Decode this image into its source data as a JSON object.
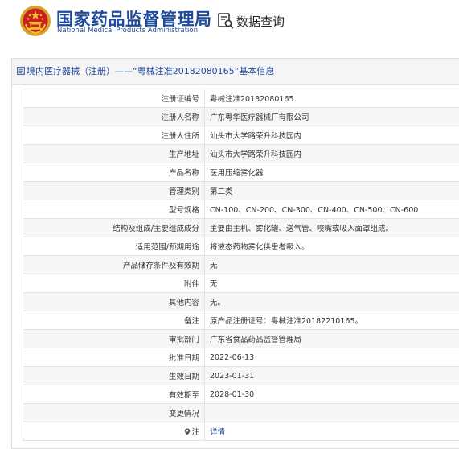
{
  "header": {
    "org_cn": "国家药品监督管理局",
    "org_en": "National Medical Products Administration",
    "query_label": "数据查询",
    "emblem_icon": "national-emblem-icon",
    "query_icon": "search-document-icon",
    "brand_color": "#1e4a9c"
  },
  "panel": {
    "title": "境内医疗器械（注册）——“粤械注准20182080165”基本信息",
    "title_icon": "document-icon"
  },
  "rows": [
    {
      "label": "注册证编号",
      "value": "粤械注准20182080165"
    },
    {
      "label": "注册人名称",
      "value": "广东粤华医疗器械厂有限公司"
    },
    {
      "label": "注册人住所",
      "value": "汕头市大学路荣升科技园内"
    },
    {
      "label": "生产地址",
      "value": "汕头市大学路荣升科技园内"
    },
    {
      "label": "产品名称",
      "value": "医用压缩雾化器"
    },
    {
      "label": "管理类别",
      "value": "第二类"
    },
    {
      "label": "型号规格",
      "value": "CN-100、CN-200、CN-300、CN-400、CN-500、CN-600"
    },
    {
      "label": "结构及组成/主要组成成分",
      "value": "主要由主机、雾化罐、送气管、咬嘴或吸入面罩组成。"
    },
    {
      "label": "适用范围/预期用途",
      "value": "将液态药物雾化供患者吸入。"
    },
    {
      "label": "产品储存条件及有效期",
      "value": "无"
    },
    {
      "label": "附件",
      "value": "无"
    },
    {
      "label": "其他内容",
      "value": "无。"
    },
    {
      "label": "备注",
      "value": "原产品注册证号：粤械注准20182210165。"
    },
    {
      "label": "审批部门",
      "value": "广东省食品药品监督管理局"
    },
    {
      "label": "批准日期",
      "value": "2022-06-13"
    },
    {
      "label": "生效日期",
      "value": "2023-01-31"
    },
    {
      "label": "有效期至",
      "value": "2028-01-30"
    },
    {
      "label": "变更情况",
      "value": ""
    },
    {
      "label": "注",
      "value": "详情",
      "icon": "note-icon"
    }
  ]
}
